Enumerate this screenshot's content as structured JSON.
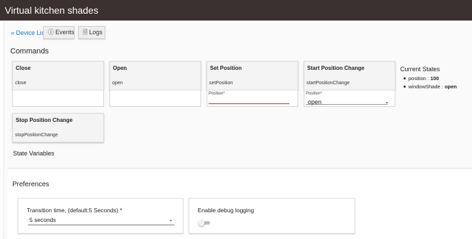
{
  "header": {
    "title": "Virtual kitchen shades"
  },
  "nav": {
    "back_link": "« Device List",
    "events_button": "Events",
    "logs_button": "Logs"
  },
  "commands": {
    "heading": "Commands",
    "cards": [
      {
        "title": "Close",
        "command": "close"
      },
      {
        "title": "Open",
        "command": "open"
      },
      {
        "title": "Set Position",
        "command": "setPosition",
        "input_label": "Position*"
      },
      {
        "title": "Start Position Change",
        "command": "startPositionChange",
        "input_label": "Position*",
        "selected": "open"
      },
      {
        "title": "Stop Position Change",
        "command": "stopPositionChange"
      }
    ]
  },
  "current_states": {
    "heading": "Current States",
    "items": [
      {
        "name": "position",
        "value": "100"
      },
      {
        "name": "windowShade",
        "value": "open"
      }
    ]
  },
  "state_variables": {
    "heading": "State Variables"
  },
  "preferences": {
    "heading": "Preferences",
    "transition": {
      "label": "Transition time, (default:5 Seconds) *",
      "value": "5 seconds"
    },
    "debug": {
      "label": "Enable debug logging",
      "enabled": false
    }
  },
  "colors": {
    "header_bg": "#3b3230",
    "link": "#1a73e8",
    "input_error_underline": "#c62828"
  },
  "icons": {
    "events": "info-circle-icon",
    "logs": "document-icon",
    "select_arrow": "chevron-down-icon"
  }
}
